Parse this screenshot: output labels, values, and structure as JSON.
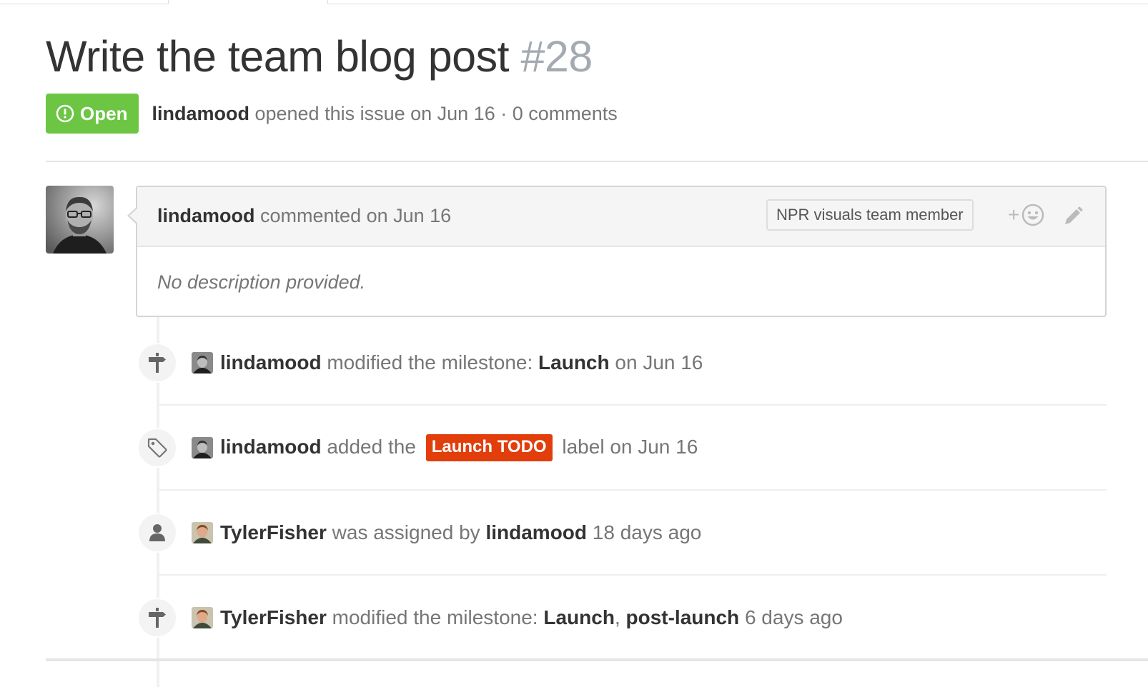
{
  "issue": {
    "title": "Write the team blog post",
    "number": "#28",
    "state": "Open",
    "author": "lindamood",
    "meta_text": "opened this issue on Jun 16 · 0 comments"
  },
  "comment": {
    "author": "lindamood",
    "action": "commented on Jun 16",
    "member_badge": "NPR visuals team member",
    "reaction_plus": "+",
    "body": "No description provided."
  },
  "timeline": [
    {
      "icon": "milestone-icon",
      "actor": "lindamood",
      "text1": "modified the milestone:",
      "milestone": "Launch",
      "text2": "on Jun 16"
    },
    {
      "icon": "tag-icon",
      "actor": "lindamood",
      "text1": "added the",
      "label": "Launch TODO",
      "text2": "label on Jun 16"
    },
    {
      "icon": "person-icon",
      "actor": "TylerFisher",
      "text1": "was assigned by",
      "by": "lindamood",
      "text2": "18 days ago"
    },
    {
      "icon": "milestone-icon",
      "actor": "TylerFisher",
      "text1": "modified the milestone:",
      "milestone_a": "Launch",
      "sep": ",",
      "milestone_b": "post-launch",
      "text2": "6 days ago"
    }
  ],
  "colors": {
    "open_badge": "#6cc644",
    "label_launch_todo": "#e23e0c",
    "number_gray": "#a3aab1"
  }
}
